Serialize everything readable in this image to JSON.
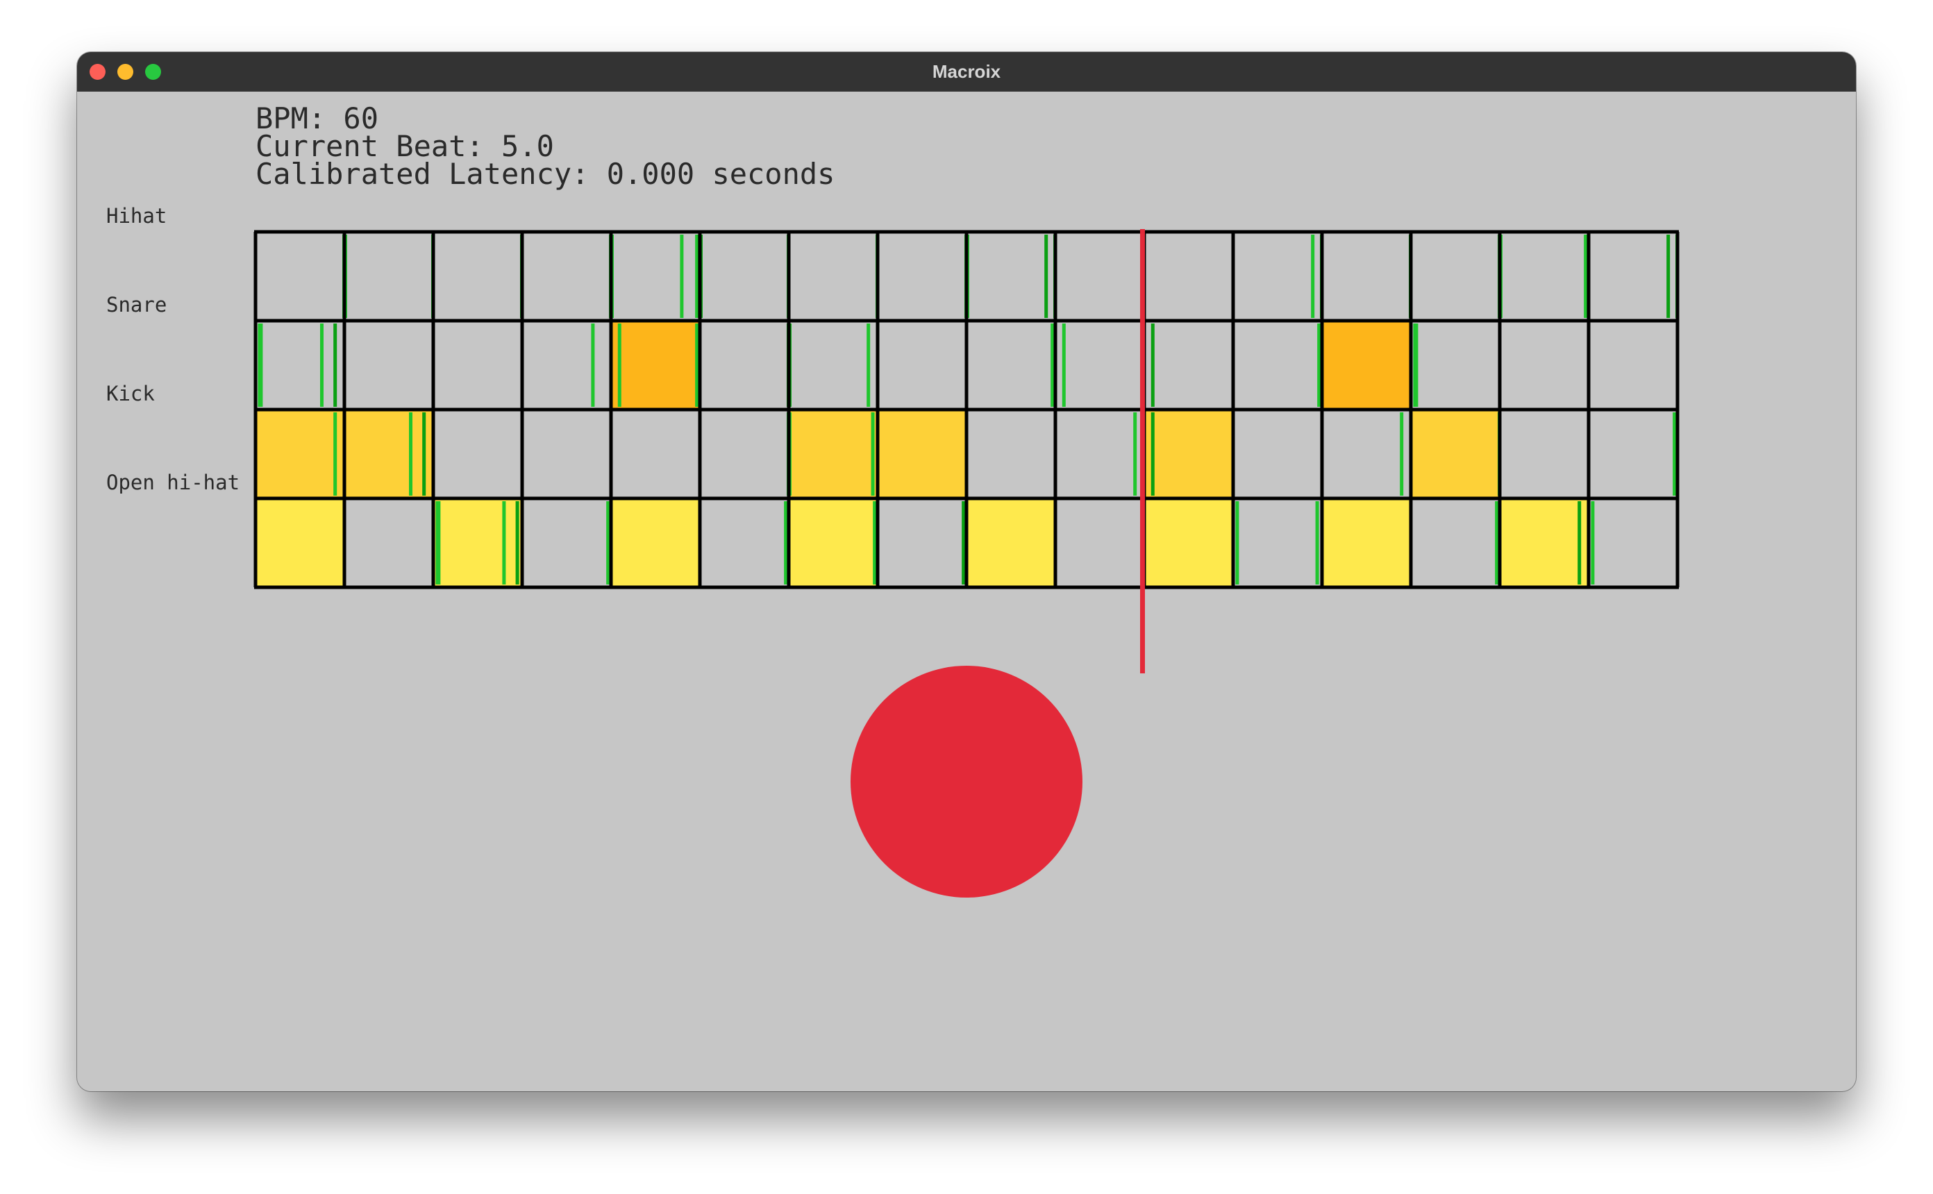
{
  "window": {
    "title": "Macroix"
  },
  "info": {
    "bpm_line": "BPM: 60",
    "beat_line": "Current Beat: 5.0",
    "latency_line": "Calibrated Latency: 0.000 seconds"
  },
  "sequencer": {
    "steps": 16,
    "playhead_step": 10,
    "tracks": [
      {
        "label": "Hihat",
        "color": "#fdba1f",
        "active": [],
        "hit_marks": [
          1,
          2,
          3,
          4,
          4.8,
          4.97,
          5,
          6,
          7,
          8,
          8.9,
          9,
          11.9,
          12,
          13,
          14,
          14.97,
          15,
          15.9,
          16
        ]
      },
      {
        "label": "Snare",
        "color": "#fdb51a",
        "active": [
          4,
          12
        ],
        "hit_marks": [
          0.05,
          0.75,
          0.9,
          3.8,
          4.1,
          4.97,
          6,
          6.9,
          8.97,
          9.1,
          10.1,
          11.97,
          13.05
        ]
      },
      {
        "label": "Kick",
        "color": "#fdd138",
        "active": [
          0,
          1,
          6,
          7,
          10,
          13
        ],
        "hit_marks": [
          0.9,
          1.75,
          1.9,
          6,
          6.95,
          9.9,
          10.1,
          12.9,
          14,
          15.97
        ]
      },
      {
        "label": "Open hi-hat",
        "color": "#fee94d",
        "active": [
          0,
          2,
          4,
          6,
          8,
          10,
          12,
          14
        ],
        "hit_marks": [
          2.05,
          2.8,
          2.95,
          3.97,
          5.97,
          6.97,
          7.97,
          11.05,
          11.95,
          13.97,
          14.9,
          15.05
        ]
      }
    ]
  },
  "colors": {
    "background": "#c6c6c6",
    "grid_line": "#000000",
    "hit_mark": "#1fc62d",
    "hit_mark_dark": "#0aa012",
    "playhead": "#e32939",
    "record_button": "#e32939"
  }
}
